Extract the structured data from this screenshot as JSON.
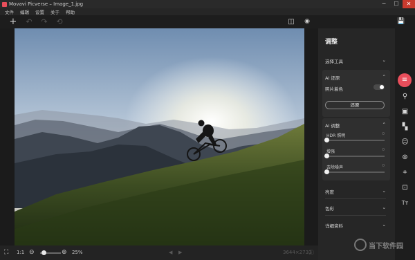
{
  "app": {
    "title": "Movavi Picverse – Image_1.jpg",
    "logo_icon": "app-logo-icon"
  },
  "window_controls": {
    "minimize": "─",
    "maximize": "☐",
    "close": "✕"
  },
  "menu": [
    "文件",
    "编辑",
    "设置",
    "关于",
    "帮助"
  ],
  "toolbar": {
    "add": "+",
    "undo": "↶",
    "redo": "↷",
    "reset": "⟲",
    "compare": "◫",
    "preview": "◉",
    "save": "💾"
  },
  "bottombar": {
    "fullscreen": "⛶",
    "actual_size": "1:1",
    "zoom_out": "⊖",
    "zoom_in": "⊕",
    "zoom_level": "25%",
    "zoom_fraction": 0.15,
    "prev": "◀",
    "next": "▶",
    "dimensions": "3644×2733",
    "info": "ⓘ"
  },
  "panel": {
    "title": "调整",
    "select_tool": {
      "label": "选择工具",
      "chevron": "⌄"
    },
    "ai_restore": {
      "label": "AI 还原",
      "chevron": "⌃",
      "colorize_label": "照片着色",
      "colorize_on": false,
      "restore_button": "还原"
    },
    "ai_adjust": {
      "label": "AI 调整",
      "chevron": "⌃",
      "sliders": [
        {
          "label": "HDR 照明",
          "value": "0"
        },
        {
          "label": "增强",
          "value": "0"
        },
        {
          "label": "去除噪声",
          "value": "0"
        }
      ]
    },
    "collapsed_sections": [
      {
        "label": "亮度",
        "chevron": "⌄"
      },
      {
        "label": "色彩",
        "chevron": "⌄"
      },
      {
        "label": "详细资料",
        "chevron": "⌄"
      }
    ]
  },
  "sidebar_tools": [
    {
      "icon": "adjust-sliders-icon",
      "glyph": "≡",
      "active": true
    },
    {
      "icon": "stamp-icon",
      "glyph": "⚲",
      "active": false
    },
    {
      "icon": "replace-background-icon",
      "glyph": "▣",
      "active": false
    },
    {
      "icon": "chessboard-icon",
      "glyph": "▚",
      "active": false
    },
    {
      "icon": "face-retouch-icon",
      "glyph": "☺",
      "active": false
    },
    {
      "icon": "filters-icon",
      "glyph": "⊛",
      "active": false
    },
    {
      "icon": "crop-icon",
      "glyph": "⌗",
      "active": false
    },
    {
      "icon": "object-removal-icon",
      "glyph": "⊡",
      "active": false
    },
    {
      "icon": "text-icon",
      "glyph": "Tт",
      "active": false
    }
  ],
  "watermark": {
    "text": "当下软件园"
  },
  "colors": {
    "accent": "#e94e5b",
    "panel_bg": "#262626",
    "app_bg": "#1b1b1b"
  }
}
